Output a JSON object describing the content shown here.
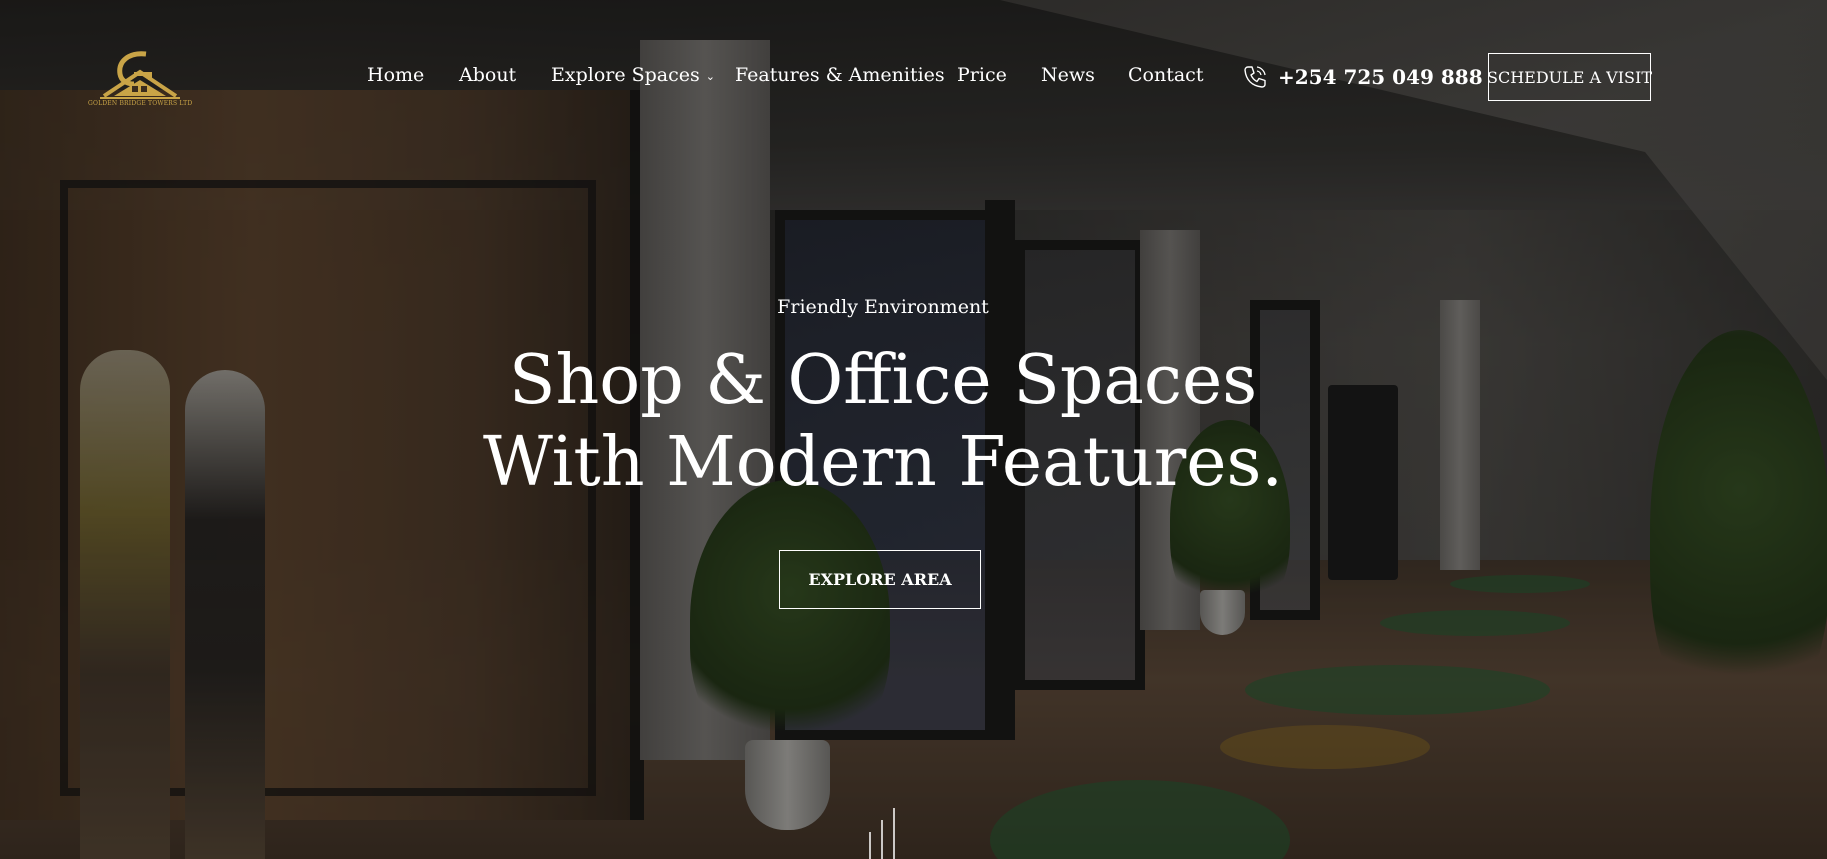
{
  "brand": {
    "logo_caption": "GOLDEN BRIDGE TOWERS LTD",
    "logo_color": "#c9a447"
  },
  "nav": {
    "items": [
      {
        "label": "Home"
      },
      {
        "label": "About"
      },
      {
        "label": "Explore Spaces",
        "has_dropdown": true
      },
      {
        "label": "Features & Amenities"
      },
      {
        "label": "Price"
      },
      {
        "label": "News"
      },
      {
        "label": "Contact"
      }
    ],
    "chevron_glyph": "⌄"
  },
  "contact": {
    "phone_icon": "phone-icon",
    "phone": "+254 725 049 888"
  },
  "cta": {
    "schedule_label": "SCHEDULE A VISIT"
  },
  "hero": {
    "eyebrow": "Friendly Environment",
    "headline_line1": "Shop & Office Spaces",
    "headline_line2": "With Modern Features.",
    "explore_label": "EXPLORE AREA"
  },
  "colors": {
    "text": "#ffffff",
    "accent_gold": "#c9a447"
  }
}
